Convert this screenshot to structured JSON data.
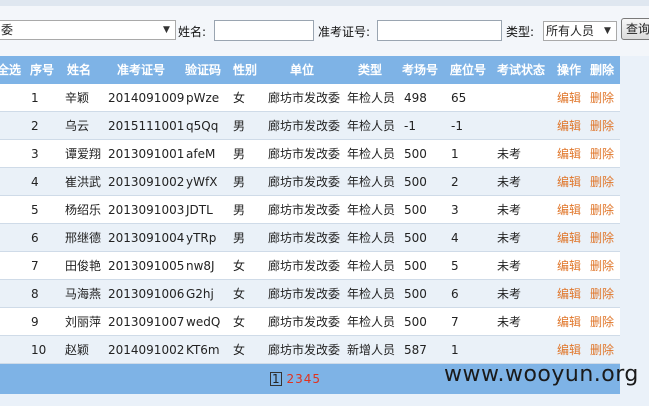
{
  "filter": {
    "dept_select_value": "委",
    "name_label": "姓名:",
    "name_value": "",
    "exam_id_label": "准考证号:",
    "exam_id_value": "",
    "type_label": "类型:",
    "type_select_value": "所有人员",
    "query_button": "查询"
  },
  "table": {
    "headers": [
      "全选",
      "序号",
      "姓名",
      "准考证号",
      "验证码",
      "性别",
      "单位",
      "类型",
      "考场号",
      "座位号",
      "考试状态",
      "操作",
      "删除"
    ],
    "rows": [
      [
        "1",
        "辛颖",
        "2014091009",
        "pWze",
        "女",
        "廊坊市发改委",
        "年检人员",
        "498",
        "65",
        "",
        "编辑",
        "删除"
      ],
      [
        "2",
        "乌云",
        "2015111001",
        "q5Qq",
        "男",
        "廊坊市发改委",
        "年检人员",
        "-1",
        "-1",
        "",
        "编辑",
        "删除"
      ],
      [
        "3",
        "谭爱翔",
        "2013091001",
        "afeM",
        "男",
        "廊坊市发改委",
        "年检人员",
        "500",
        "1",
        "未考",
        "编辑",
        "删除"
      ],
      [
        "4",
        "崔洪武",
        "2013091002",
        "yWfX",
        "男",
        "廊坊市发改委",
        "年检人员",
        "500",
        "2",
        "未考",
        "编辑",
        "删除"
      ],
      [
        "5",
        "杨绍乐",
        "2013091003",
        "JDTL",
        "男",
        "廊坊市发改委",
        "年检人员",
        "500",
        "3",
        "未考",
        "编辑",
        "删除"
      ],
      [
        "6",
        "邢继德",
        "2013091004",
        "yTRp",
        "男",
        "廊坊市发改委",
        "年检人员",
        "500",
        "4",
        "未考",
        "编辑",
        "删除"
      ],
      [
        "7",
        "田俊艳",
        "2013091005",
        "nw8J",
        "女",
        "廊坊市发改委",
        "年检人员",
        "500",
        "5",
        "未考",
        "编辑",
        "删除"
      ],
      [
        "8",
        "马海燕",
        "2013091006",
        "G2hj",
        "女",
        "廊坊市发改委",
        "年检人员",
        "500",
        "6",
        "未考",
        "编辑",
        "删除"
      ],
      [
        "9",
        "刘丽萍",
        "2013091007",
        "wedQ",
        "女",
        "廊坊市发改委",
        "年检人员",
        "500",
        "7",
        "未考",
        "编辑",
        "删除"
      ],
      [
        "10",
        "赵颖",
        "2014091002",
        "KT6m",
        "女",
        "廊坊市发改委",
        "新增人员",
        "587",
        "1",
        "",
        "编辑",
        "删除"
      ]
    ]
  },
  "pager": {
    "current": "1",
    "pages": [
      "2",
      "3",
      "4",
      "5"
    ]
  },
  "watermark": "www.wooyun.org",
  "colors": {
    "header_bg": "#7eb3e6",
    "link": "#e0762a",
    "page_link": "#e0321e"
  }
}
